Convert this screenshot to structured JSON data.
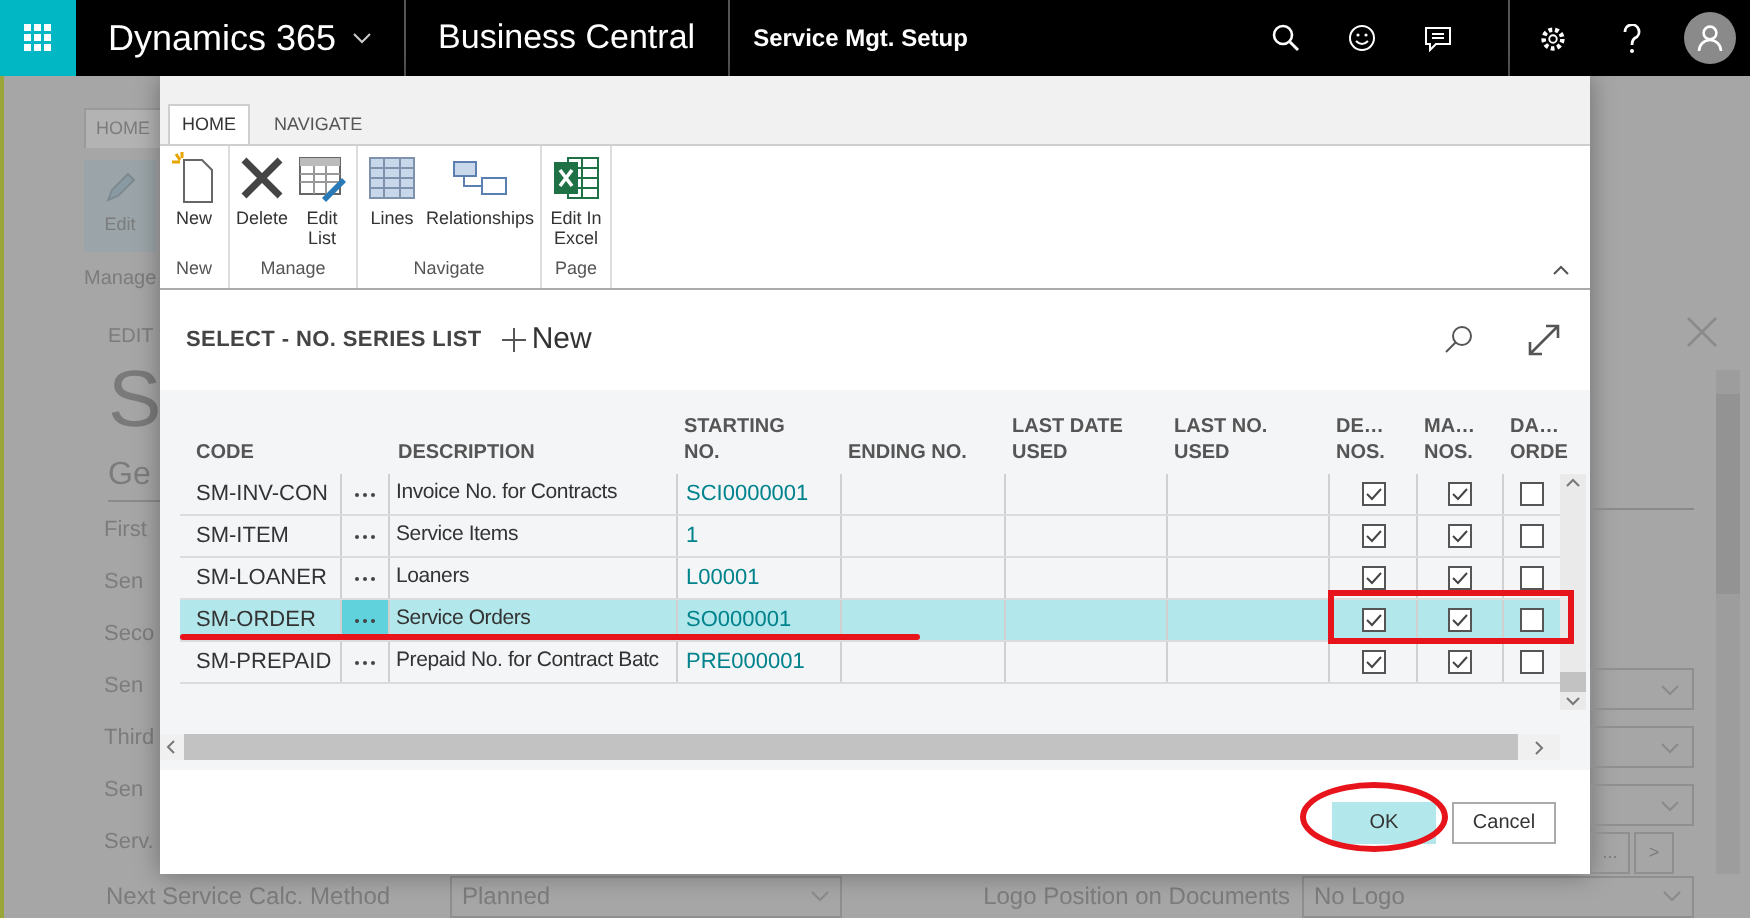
{
  "top_bar": {
    "app_name": "Dynamics 365",
    "product": "Business Central",
    "page": "Service Mgt. Setup"
  },
  "background_page": {
    "ribbon_tab": "HOME",
    "action": "Edit",
    "group": "Manage",
    "breadcrumb": "EDIT",
    "title": "S",
    "section": "Ge",
    "field_labels": [
      "First",
      "Sen",
      "Seco",
      "Sen",
      "Third",
      "Sen",
      "Serv."
    ],
    "side_button_labels": [
      "...",
      ">"
    ],
    "bottom_fields": [
      {
        "label": "Next Service Calc. Method",
        "value": "Planned"
      },
      {
        "label": "Logo Position on Documents",
        "value": "No Logo"
      }
    ]
  },
  "dialog": {
    "ribbon_tabs": [
      {
        "label": "HOME",
        "selected": true
      },
      {
        "label": "NAVIGATE",
        "selected": false
      }
    ],
    "ribbon_groups": [
      {
        "name": "New",
        "actions": [
          {
            "label": "New",
            "kind": "new"
          }
        ]
      },
      {
        "name": "Manage",
        "actions": [
          {
            "label": "Delete",
            "kind": "delete"
          },
          {
            "label": "Edit List",
            "kind": "edit-list"
          }
        ]
      },
      {
        "name": "Navigate",
        "actions": [
          {
            "label": "Lines",
            "kind": "lines"
          },
          {
            "label": "Relationships",
            "kind": "relationships"
          }
        ]
      },
      {
        "name": "Page",
        "actions": [
          {
            "label": "Edit In Excel",
            "kind": "excel"
          }
        ]
      }
    ],
    "title": "SELECT - NO. SERIES LIST",
    "new_action": "New",
    "table": {
      "columns": [
        {
          "lines": [
            "CODE"
          ]
        },
        {
          "lines": [
            "DESCRIPTION"
          ]
        },
        {
          "lines": [
            "STARTING",
            "NO."
          ]
        },
        {
          "lines": [
            "ENDING NO."
          ]
        },
        {
          "lines": [
            "LAST DATE",
            "USED"
          ]
        },
        {
          "lines": [
            "LAST NO.",
            "USED"
          ]
        },
        {
          "lines": [
            "DE…",
            "NOS."
          ]
        },
        {
          "lines": [
            "MA…",
            "NOS."
          ]
        },
        {
          "lines": [
            "DA…",
            "ORDE"
          ]
        }
      ],
      "rows": [
        {
          "code": "SM-INV-CON",
          "description": "Invoice No. for Contracts",
          "starting_no": "SCI0000001",
          "default_nos": true,
          "manual_nos": true,
          "date_order": false,
          "selected": false
        },
        {
          "code": "SM-ITEM",
          "description": "Service Items",
          "starting_no": "1",
          "default_nos": true,
          "manual_nos": true,
          "date_order": false,
          "selected": false
        },
        {
          "code": "SM-LOANER",
          "description": "Loaners",
          "starting_no": "L00001",
          "default_nos": true,
          "manual_nos": true,
          "date_order": false,
          "selected": false
        },
        {
          "code": "SM-ORDER",
          "description": "Service Orders",
          "starting_no": "SO000001",
          "default_nos": true,
          "manual_nos": true,
          "date_order": false,
          "selected": true
        },
        {
          "code": "SM-PREPAID",
          "description": "Prepaid No. for Contract Batc",
          "starting_no": "PRE000001",
          "default_nos": true,
          "manual_nos": true,
          "date_order": false,
          "selected": false
        }
      ]
    },
    "buttons": [
      {
        "label": "OK",
        "selected": true
      },
      {
        "label": "Cancel",
        "selected": false
      }
    ]
  }
}
